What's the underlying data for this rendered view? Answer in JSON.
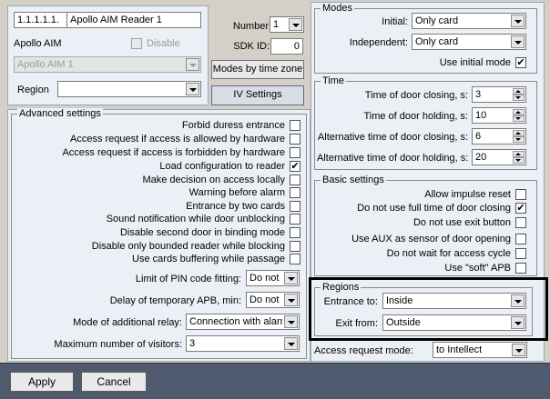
{
  "reader": {
    "id_value": "1.1.1.1.1.",
    "name_value": "Apollo AIM Reader 1",
    "number_label": "Number",
    "number_value": "1",
    "sdk_label": "SDK ID:",
    "sdk_value": "0",
    "parent_label": "Apollo AIM",
    "disable_label": "Disable",
    "parent_select": "Apollo AIM 1",
    "region_label": "Region",
    "region_value": "",
    "modes_by_time_zone": "Modes by time zone",
    "iv_settings": "IV Settings"
  },
  "modes": {
    "legend": "Modes",
    "initial_label": "Initial:",
    "initial_value": "Only card",
    "independent_label": "Independent:",
    "independent_value": "Only card",
    "use_initial_mode": "Use initial mode",
    "use_initial_mode_checked": true
  },
  "time": {
    "legend": "Time",
    "rows": [
      {
        "label": "Time of door closing, s:",
        "value": "3"
      },
      {
        "label": "Time of door holding, s:",
        "value": "10"
      },
      {
        "label": "Alternative time of door closing, s:",
        "value": "6"
      },
      {
        "label": "Alternative time of door holding, s:",
        "value": "20"
      }
    ]
  },
  "basic": {
    "legend": "Basic settings",
    "items": [
      {
        "label": "Allow impulse reset",
        "checked": false
      },
      {
        "label": "Do not use full time of door closing",
        "checked": true
      },
      {
        "label": "Do not use exit button",
        "checked": false
      },
      {
        "label": "Use AUX as sensor of door opening",
        "checked": false
      },
      {
        "label": "Do not wait for access cycle",
        "checked": false
      },
      {
        "label": "Use \"soft\" APB",
        "checked": false
      }
    ]
  },
  "regions": {
    "legend": "Regions",
    "entrance_label": "Entrance to:",
    "entrance_value": "Inside",
    "exit_label": "Exit from:",
    "exit_value": "Outside"
  },
  "access_request": {
    "label": "Access request mode:",
    "value": "to Intellect"
  },
  "advanced": {
    "legend": "Advanced settings",
    "items": [
      {
        "label": "Forbid duress entrance",
        "checked": false
      },
      {
        "label": "Access request if access is allowed by hardware",
        "checked": false
      },
      {
        "label": "Access request if access is forbidden by hardware",
        "checked": false
      },
      {
        "label": "Load configuration to reader",
        "checked": true
      },
      {
        "label": "Make decision on access locally",
        "checked": false
      },
      {
        "label": "Warning before alarm",
        "checked": false
      },
      {
        "label": "Entrance by two cards",
        "checked": false
      },
      {
        "label": "Sound notification while door unblocking",
        "checked": false
      },
      {
        "label": "Disable second door in binding mode",
        "checked": false
      },
      {
        "label": "Disable only bounded reader while blocking",
        "checked": false
      },
      {
        "label": "Use cards buffering while passage",
        "checked": false
      }
    ],
    "pin_label": "Limit of PIN code fitting:",
    "pin_value": "Do not u",
    "apb_label": "Delay of temporary APB, min:",
    "apb_value": "Do not u",
    "relay_label": "Mode of additional relay:",
    "relay_value": "Connection with alarm",
    "visitors_label": "Maximum number of visitors:",
    "visitors_value": "3"
  },
  "footer": {
    "apply": "Apply",
    "cancel": "Cancel"
  },
  "colors": {
    "panel_bg": "#ebeff6",
    "window_bg": "#d4d0c8",
    "highlight_border": "#000000"
  }
}
